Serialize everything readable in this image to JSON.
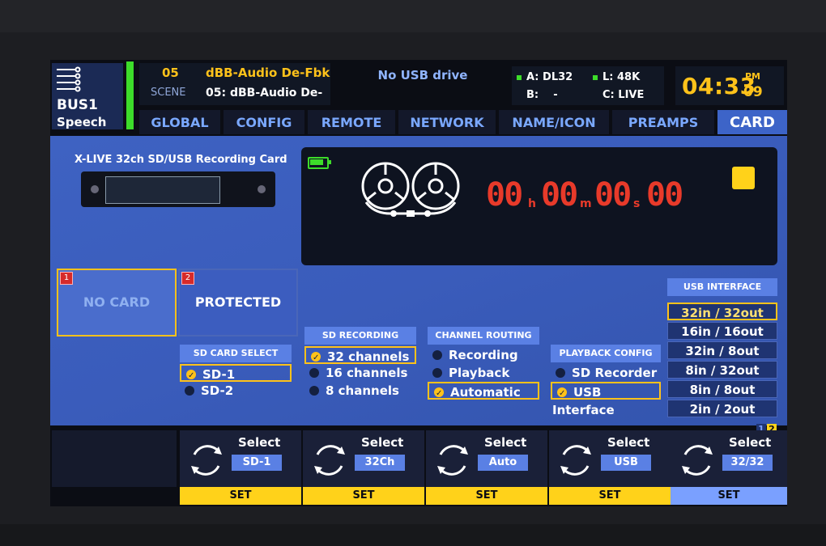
{
  "header": {
    "bus_name": "BUS1",
    "bus_sub": "Speech",
    "scene_number": "05",
    "scene_label": "SCENE",
    "scene_name": "dBB-Audio De-Fbk",
    "scene_full": "05: dBB-Audio De-",
    "usb_status": "No USB drive",
    "io_a_label": "A:",
    "io_a_value": "DL32",
    "io_b_label": "B:",
    "io_b_value": "-",
    "io_l_label": "L:",
    "io_l_value": "48K",
    "io_c_label": "C:",
    "io_c_value": "LIVE",
    "clock": "04:33",
    "ampm": "PM",
    "seconds": "09",
    "status_color": "#3ddc2a",
    "accent_color": "#ffc21a"
  },
  "tabs": [
    {
      "label": "GLOBAL",
      "active": false
    },
    {
      "label": "CONFIG",
      "active": false
    },
    {
      "label": "REMOTE",
      "active": false
    },
    {
      "label": "NETWORK",
      "active": false
    },
    {
      "label": "NAME/ICON",
      "active": false
    },
    {
      "label": "PREAMPS",
      "active": false
    },
    {
      "label": "CARD",
      "active": true
    }
  ],
  "card": {
    "title": "X-LIVE 32ch SD/USB Recording Card"
  },
  "recorder": {
    "hours": "00",
    "h_unit": "h",
    "minutes": "00",
    "m_unit": "m",
    "seconds": "00",
    "s_unit": "s",
    "frames": "00"
  },
  "slots": [
    {
      "number": "1",
      "label": "NO CARD",
      "selected": true
    },
    {
      "number": "2",
      "label": "PROTECTED",
      "selected": false
    }
  ],
  "sd_card_select": {
    "title": "SD CARD SELECT",
    "options": [
      {
        "label": "SD-1",
        "selected": true
      },
      {
        "label": "SD-2",
        "selected": false
      }
    ]
  },
  "sd_recording": {
    "title": "SD RECORDING",
    "options": [
      {
        "label": "32 channels",
        "selected": true
      },
      {
        "label": "16 channels",
        "selected": false
      },
      {
        "label": "8 channels",
        "selected": false
      }
    ]
  },
  "channel_routing": {
    "title": "CHANNEL ROUTING",
    "options": [
      {
        "label": "Recording",
        "selected": false
      },
      {
        "label": "Playback",
        "selected": false
      },
      {
        "label": "Automatic",
        "selected": true
      }
    ]
  },
  "playback_config": {
    "title": "PLAYBACK CONFIG",
    "options": [
      {
        "label": "SD Recorder",
        "selected": false
      },
      {
        "label": "USB Interface",
        "selected": true
      }
    ]
  },
  "usb_interface": {
    "title": "USB INTERFACE",
    "options": [
      {
        "label": "32in / 32out",
        "selected": true
      },
      {
        "label": "16in / 16out",
        "selected": false
      },
      {
        "label": "32in / 8out",
        "selected": false
      },
      {
        "label": "8in / 32out",
        "selected": false
      },
      {
        "label": "8in / 8out",
        "selected": false
      },
      {
        "label": "2in / 2out",
        "selected": false
      }
    ]
  },
  "pages": {
    "p1": "1",
    "p2": "2"
  },
  "knobs": [
    {
      "label": "Select",
      "value": "SD-1",
      "set": "SET"
    },
    {
      "label": "Select",
      "value": "32Ch",
      "set": "SET"
    },
    {
      "label": "Select",
      "value": "Auto",
      "set": "SET"
    },
    {
      "label": "Select",
      "value": "USB",
      "set": "SET"
    },
    {
      "label": "Select",
      "value": "32/32",
      "set": "SET"
    }
  ]
}
